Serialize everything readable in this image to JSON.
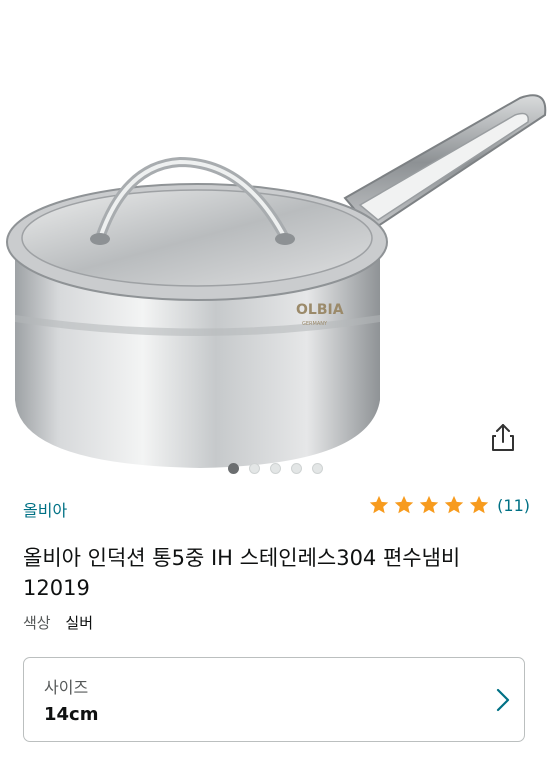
{
  "product": {
    "brand": "올비아",
    "rating_count": "(11)",
    "stars": 5,
    "title_line1": "올비아 인덕션 통5중 IH 스테인레스304 편수냄비",
    "title_line2": "12019",
    "color_label": "색상",
    "color_value": "실버",
    "size_label": "사이즈",
    "size_value": "14cm",
    "logo_text": "OLBIA",
    "logo_subtext": "GERMANY"
  },
  "gallery": {
    "total": 5,
    "active_index": 0
  },
  "colors": {
    "star": "#f79b1e",
    "link": "#007185",
    "text": "#0f1111",
    "muted": "#565959"
  }
}
